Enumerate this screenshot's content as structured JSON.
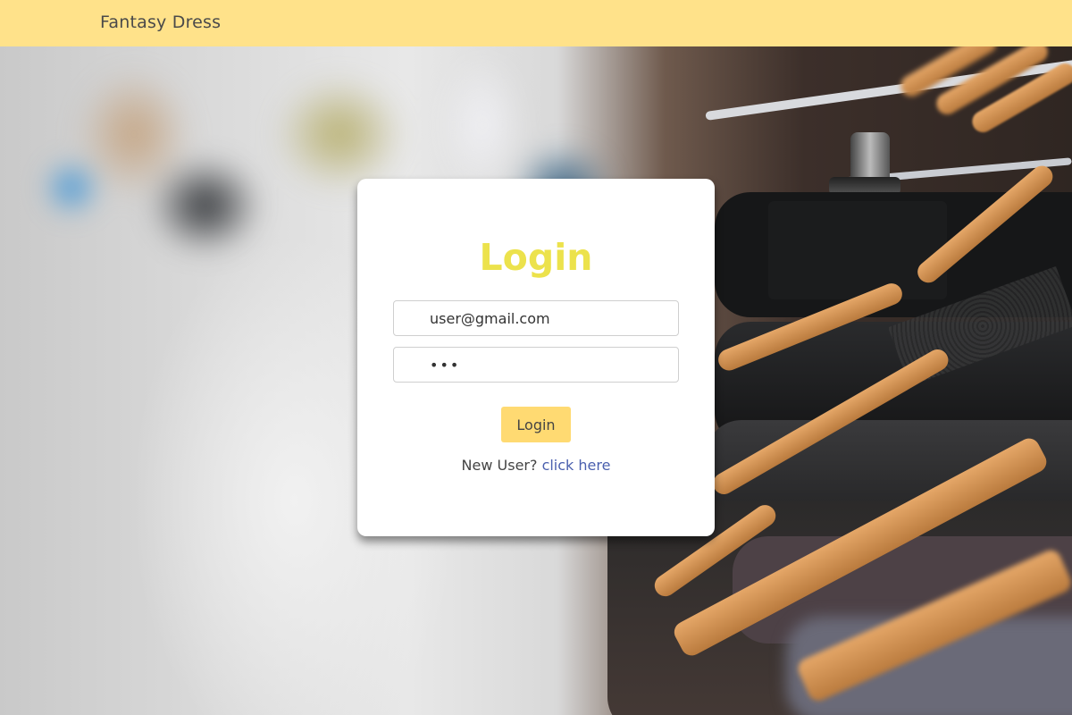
{
  "header": {
    "brand": "Fantasy Dress",
    "background_color": "#ffe28a"
  },
  "login_card": {
    "title": "Login",
    "title_color": "#ece24c",
    "email_value": "user@gmail.com",
    "password_value": "abc",
    "button_label": "Login",
    "button_color": "#ffda72",
    "signup_prompt": "New User?",
    "signup_link": "click here",
    "link_color": "#4a5fae"
  },
  "background": {
    "image": "blurred-clothing-rack-photo"
  }
}
